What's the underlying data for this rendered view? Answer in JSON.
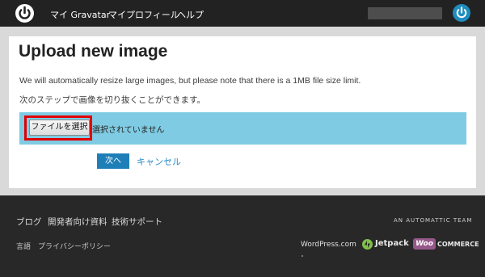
{
  "header": {
    "logo_icon": "gravatar-power-icon",
    "nav": [
      "マイ Gravatar",
      "マイプロフィール",
      "ヘルプ"
    ],
    "avatar_icon": "gravatar-avatar-icon"
  },
  "main": {
    "title": "Upload new image",
    "description": "We will automatically resize large images, but please note that there is a 1MB file size limit.",
    "instruction": "次のステップで画像を切り抜くことができます。",
    "file_button": "ファイルを選択",
    "file_status": "選択されていません",
    "next_button": "次へ",
    "cancel_link": "キャンセル"
  },
  "footer": {
    "links": [
      "ブログ",
      "開発者向け資料",
      "技術サポート"
    ],
    "secondary_links": [
      "言語",
      "プライバシーポリシー"
    ],
    "automattic": "AN AUTOMATTIC TEAM",
    "wordpress": "WordPress.com",
    "jetpack": "Jetpack",
    "woo_badge": "Woo",
    "woocommerce": "COMMERCE"
  },
  "colors": {
    "topbar": "#222222",
    "upload_bar": "#7fcbe3",
    "highlight": "#e00000",
    "accent_button": "#1e7fb8",
    "link": "#2b8ac6",
    "footer": "#282828"
  }
}
